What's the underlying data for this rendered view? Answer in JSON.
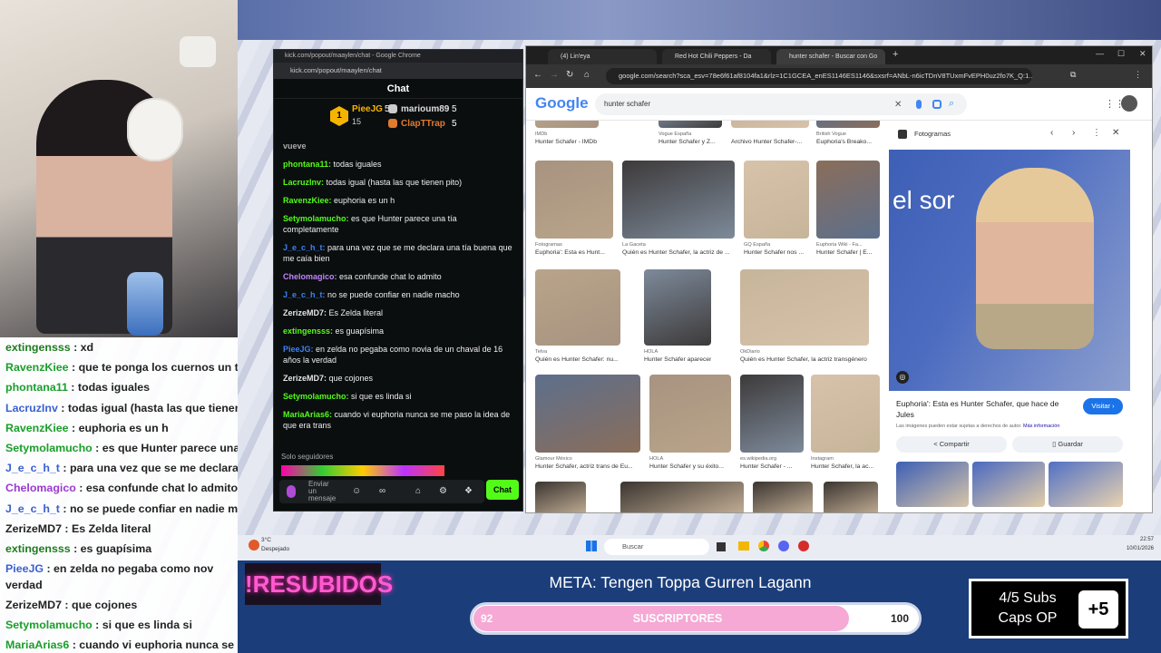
{
  "webcam_overlay": {
    "lines": [
      {
        "user": "extingensss",
        "text": " : xd",
        "color": "#1e7a1e"
      },
      {
        "user": "RavenzKiee",
        "text": " : que te ponga los cuernos un tra",
        "color": "#1a9e2a"
      },
      {
        "user": "phontana11",
        "text": " : todas iguales",
        "color": "#1a9e2a"
      },
      {
        "user": "LacruzInv",
        "text": " : todas igual (hasta las que tienen p",
        "color": "#3a60d0"
      },
      {
        "user": "RavenzKiee",
        "text": " : euphoria es un h",
        "color": "#1a9e2a"
      },
      {
        "user": "Setymolamucho",
        "text": " : es que Hunter parece una",
        "color": "#1a9e2a"
      },
      {
        "user": "J_e_c_h_t",
        "text": " : para una vez que se me declara un",
        "color": "#3a60d0"
      },
      {
        "user": "Chelomagico",
        "text": " : esa confunde chat lo admito",
        "color": "#9b3ad0"
      },
      {
        "user": "J_e_c_h_t",
        "text": " : no se puede confiar en nadie mac",
        "color": "#3a60d0"
      },
      {
        "user": "ZerizeMD7",
        "text": " : Es Zelda literal",
        "color": "#222"
      },
      {
        "user": "extingensss",
        "text": " : es guapísima",
        "color": "#1e7a1e"
      },
      {
        "user": "PieeJG",
        "text": " : en zelda no pegaba como nov verdad",
        "color": "#3a60d0"
      },
      {
        "user": "ZerizeMD7",
        "text": " : que cojones",
        "color": "#222"
      },
      {
        "user": "Setymolamucho",
        "text": " : si que es linda si",
        "color": "#1a9e2a"
      },
      {
        "user": "MariaArias6",
        "text": " : cuando vi euphoria nunca se me",
        "color": "#1a9e2a"
      }
    ]
  },
  "kick_window": {
    "title": "kick.com/popout/maaylen/chat - Google Chrome",
    "url": "kick.com/popout/maaylen/chat",
    "header": "Chat",
    "gifters": {
      "rank": "1",
      "first": {
        "name": "PieeJG",
        "count": "5"
      },
      "first_sub": "15",
      "second": {
        "name": "marioum89",
        "count": "5"
      },
      "third": {
        "name": "ClapTTrap",
        "count": "5"
      }
    },
    "messages": [
      {
        "user": "vueve",
        "text": "",
        "color": "#aaa"
      },
      {
        "user": "phontana11:",
        "text": " todas iguales",
        "color": "#53fc18"
      },
      {
        "user": "LacruzInv:",
        "text": " todas igual (hasta las que tienen pito)",
        "color": "#53fc18"
      },
      {
        "user": "RavenzKiee:",
        "text": " euphoria es un h",
        "color": "#53fc18"
      },
      {
        "user": "Setymolamucho:",
        "text": " es que Hunter parece una tía completamente",
        "color": "#53fc18"
      },
      {
        "user": "J_e_c_h_t:",
        "text": " para una vez que se me declara una tía buena que me caía bien",
        "color": "#3b82f6"
      },
      {
        "user": "Chelomagico:",
        "text": " esa confunde chat lo admito",
        "color": "#c084fc"
      },
      {
        "user": "J_e_c_h_t:",
        "text": " no se puede confiar en nadie macho",
        "color": "#3b82f6"
      },
      {
        "user": "ZerizeMD7:",
        "text": " Es Zelda literal",
        "color": "#e5e5e5"
      },
      {
        "user": "extingensss:",
        "text": " es guapísima",
        "color": "#53fc18"
      },
      {
        "user": "PieeJG:",
        "text": " en zelda no pegaba como novia de un chaval de 16 años la verdad",
        "color": "#3b82f6"
      },
      {
        "user": "ZerizeMD7:",
        "text": " que cojones",
        "color": "#e5e5e5"
      },
      {
        "user": "Setymolamucho:",
        "text": " si que es linda si",
        "color": "#53fc18"
      },
      {
        "user": "MariaArias6:",
        "text": " cuando vi euphoria nunca se me paso la idea de que era trans",
        "color": "#53fc18"
      }
    ],
    "followers_only": "Solo seguidores",
    "input_placeholder": "Enviar un mensaje",
    "chat_button": "Chat"
  },
  "google_window": {
    "tabs": [
      "(4) Lin'eya",
      "Red Hot Chili Peppers - Da",
      "hunter schafer - Buscar con Go"
    ],
    "address": "google.com/search?sca_esv=78e6f61af8104fa1&rlz=1C1GCEA_enES1146ES1146&sxsrf=ANbL-n6icTDnV8TUxmFvEPH0uz2fo7K_Q:1...",
    "logo": "Google",
    "query": "hunter schafer",
    "row0": [
      {
        "src": "IMDb",
        "cap": "Hunter Schafer - IMDb"
      },
      {
        "src": "Vogue España",
        "cap": "Hunter Schafer y Z..."
      },
      {
        "src": "",
        "cap": "Archivo Hunter Schafer-..."
      },
      {
        "src": "British Vogue",
        "cap": "Euphoria's Breako..."
      }
    ],
    "row1": [
      {
        "src": "Fotogramas",
        "cap": "Euphoria': Esta es Hunt..."
      },
      {
        "src": "La Gaceta",
        "cap": "Quién es Hunter Schafer, la actriz de ..."
      },
      {
        "src": "GQ España",
        "cap": "Hunter Schafer nos ..."
      },
      {
        "src": "Euphoria Wiki - Fa...",
        "cap": "Hunter Schafer | E..."
      }
    ],
    "row2": [
      {
        "src": "Telva",
        "cap": "Quién es Hunter Schafer: nu..."
      },
      {
        "src": "HOLA",
        "cap": "Hunter Schafer apareceré..."
      },
      {
        "src": "OkDiario",
        "cap": "Quién es Hunter Schafer, la actriz transgénero de ..."
      }
    ],
    "row3": [
      {
        "src": "Glamour México",
        "cap": "Hunter Schafer, actriz trans de Eu..."
      },
      {
        "src": "HOLA",
        "cap": "Hunter Schafer y su éxito..."
      },
      {
        "src": "es.wikipedia.org",
        "cap": "Hunter Schafer - ..."
      },
      {
        "src": "Instagram",
        "cap": "Hunter Schafer, la ac..."
      }
    ],
    "panel": {
      "source": "Fotogramas",
      "photo_text": "el sor",
      "title": "Euphoria': Esta es Hunter Schafer, que hace de Jules",
      "visit": "Visitar",
      "notice": "Las imágenes pueden estar sujetas a derechos de autor.",
      "notice_link": "Más información",
      "share": "Compartir",
      "save": "Guardar"
    }
  },
  "taskbar": {
    "weather_temp": "3°C",
    "weather_text": "Despejado",
    "search": "Buscar",
    "time": "22:57",
    "date": "10/01/2026"
  },
  "stream_overlay": {
    "resubidos": "!RESUBIDOS",
    "meta": "META: Tengen Toppa Gurren Lagann",
    "bar_label": "SUSCRIPTORES",
    "bar_current": "92",
    "bar_max": "100",
    "bar_progress": 0.92,
    "subs_line1": "4/5 Subs",
    "subs_line2": "Caps OP",
    "subs_plus": "+5"
  },
  "colors": {
    "kick_green": "#53fc18",
    "google_blue": "#1a73e8",
    "overlay_pink": "#f5a9d4"
  }
}
